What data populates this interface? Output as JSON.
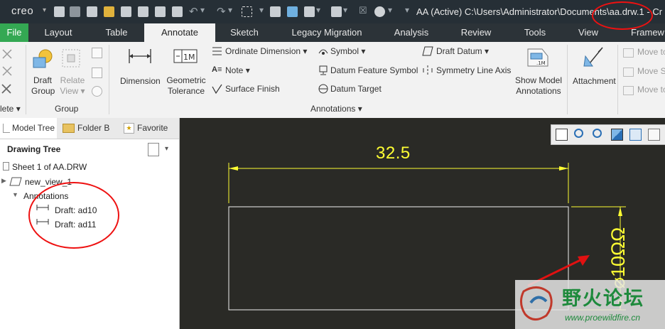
{
  "titlebar": {
    "app_name": "creo",
    "title": "AA (Active) C:\\Users\\Administrator\\Documents\\aa.drw.1 - Cr"
  },
  "tabs": [
    "File",
    "Layout",
    "Table",
    "Annotate",
    "Sketch",
    "Legacy Migration",
    "Analysis",
    "Review",
    "Tools",
    "View",
    "Framew"
  ],
  "ribbon": {
    "delete_group_label": "lete",
    "group_group": {
      "draft_group": "Draft Group",
      "relate_view": "Relate View",
      "label": "Group"
    },
    "annotations": {
      "dimension": "Dimension",
      "geometric_tolerance": "Geometric Tolerance",
      "ordinate_dimension": "Ordinate Dimension",
      "note": "Note",
      "surface_finish": "Surface Finish",
      "symbol": "Symbol",
      "datum_feature_symbol": "Datum Feature Symbol",
      "datum_target": "Datum Target",
      "draft_datum": "Draft Datum",
      "symmetry_line_axis": "Symmetry Line Axis",
      "show_model_annotations": "Show Model Annotations",
      "label": "Annotations"
    },
    "attachment": "Attachment",
    "move": [
      "Move to",
      "Move S",
      "Move to"
    ]
  },
  "panel": {
    "tabs": [
      "Model Tree",
      "Folder B",
      "Favorite"
    ],
    "tree_title": "Drawing Tree",
    "items": [
      "Sheet 1 of AA.DRW",
      "new_view_1",
      "Annotations",
      "Draft: ad10",
      "Draft: ad11"
    ]
  },
  "drawing": {
    "dim_horizontal": "32.5",
    "dim_vertical": "⌀10ΩΩ"
  },
  "watermark": {
    "text": "野火论坛",
    "url": "www.proewildfire.cn"
  },
  "colors": {
    "file_tab": "#34a853",
    "dimension": "#ffff33",
    "annotation_red": "#e11111",
    "canvas_bg": "#2a2a26"
  }
}
